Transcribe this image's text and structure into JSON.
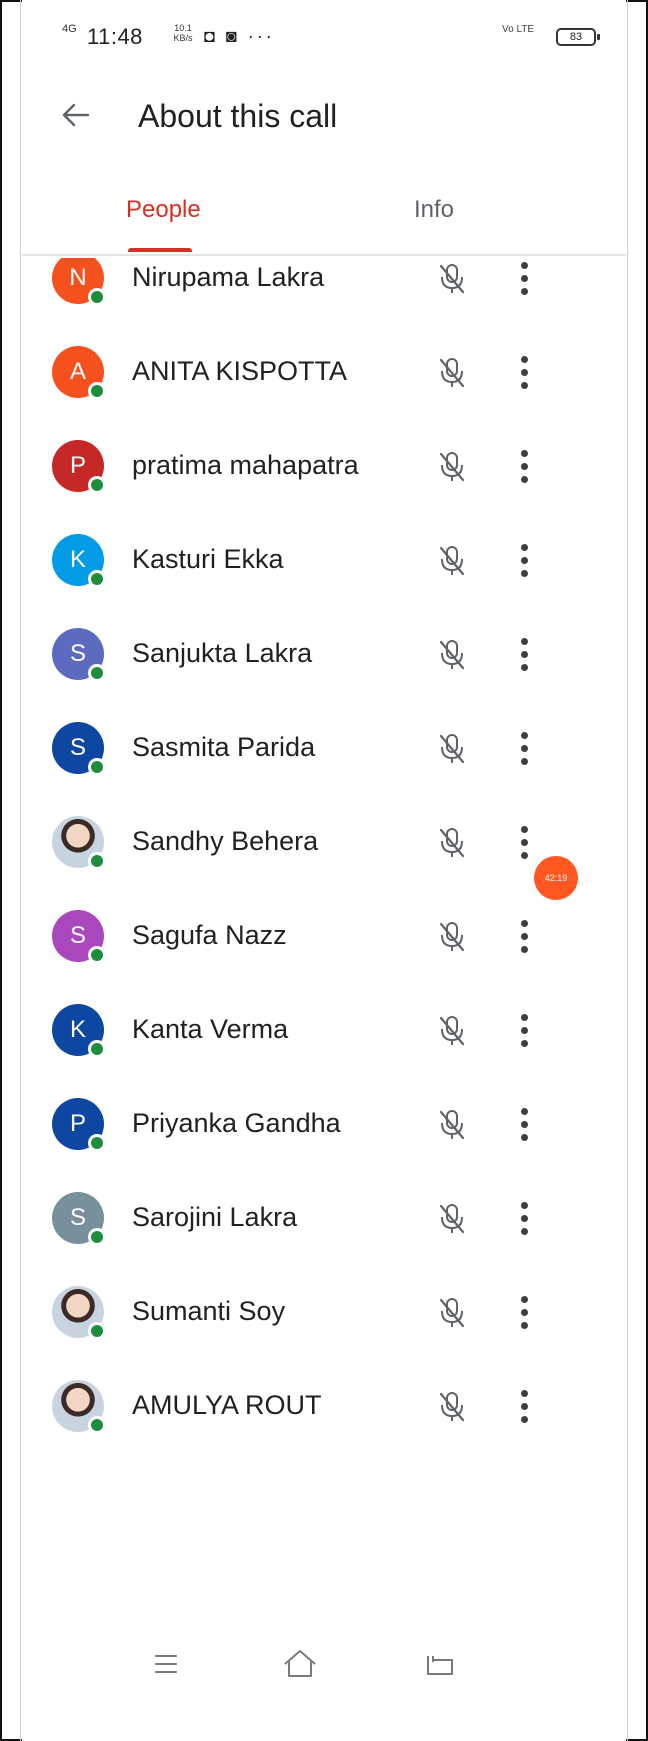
{
  "status_bar": {
    "signal": "4G",
    "time": "11:48",
    "speed_value": "10.1",
    "speed_unit": "KB/s",
    "notification_icons": "◘ ◙ ···",
    "network_label": "Vo LTE",
    "battery": "83"
  },
  "header": {
    "title": "About this call",
    "back_icon": "arrow-left-icon"
  },
  "tabs": [
    {
      "label": "People",
      "active": true
    },
    {
      "label": "Info",
      "active": false
    }
  ],
  "participants": [
    {
      "name": "Nirupama Lakra",
      "initial": "N",
      "color": "#f4511e"
    },
    {
      "name": "ANITA KISPOTTA",
      "initial": "A",
      "color": "#f4511e"
    },
    {
      "name": "pratima mahapatra",
      "initial": "P",
      "color": "#c62828"
    },
    {
      "name": "Kasturi Ekka",
      "initial": "K",
      "color": "#039be5"
    },
    {
      "name": "Sanjukta Lakra",
      "initial": "S",
      "color": "#5c6bc0"
    },
    {
      "name": "Sasmita Parida",
      "initial": "S",
      "color": "#0d47a1"
    },
    {
      "name": "Sandhy Behera",
      "initial": "",
      "color": "#b0bec5",
      "photo": true
    },
    {
      "name": "Sagufa Nazz",
      "initial": "S",
      "color": "#ab47bc"
    },
    {
      "name": "Kanta Verma",
      "initial": "K",
      "color": "#0d47a1"
    },
    {
      "name": "Priyanka Gandha",
      "initial": "P",
      "color": "#0d47a1"
    },
    {
      "name": "Sarojini Lakra",
      "initial": "S",
      "color": "#78909c"
    },
    {
      "name": "Sumanti Soy",
      "initial": "",
      "color": "#b0bec5",
      "photo": true
    },
    {
      "name": "AMULYA ROUT",
      "initial": "",
      "color": "#b0bec5",
      "photo": true
    }
  ],
  "participant_icons": {
    "mic": "mic-off-icon",
    "menu": "more-vert-icon"
  },
  "timer_badge": "42:19",
  "colors": {
    "accent": "#d93025",
    "online": "#1e8e3e",
    "badge": "#ff5722"
  },
  "nav_bar": {
    "menu": "menu-icon",
    "home": "home-icon",
    "back": "back-icon"
  }
}
